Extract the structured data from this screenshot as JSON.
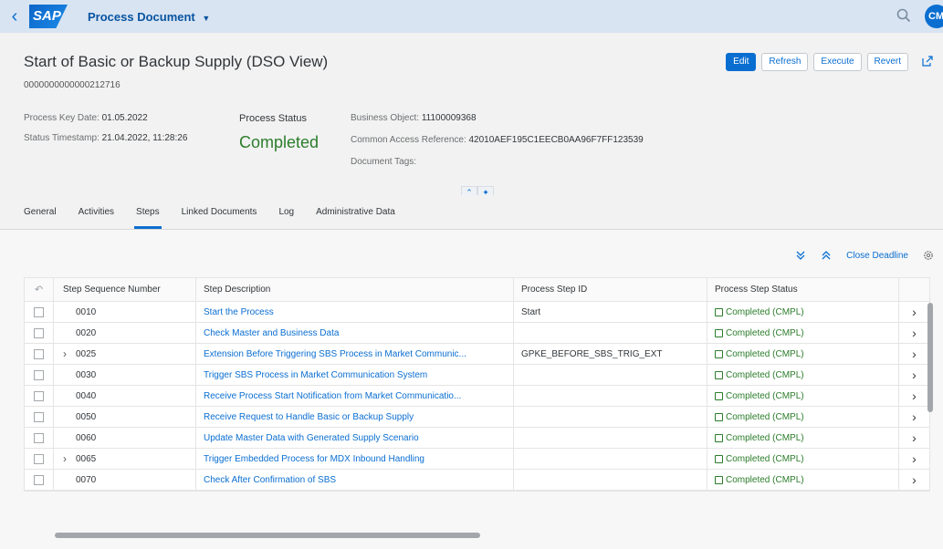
{
  "shell": {
    "logo": "SAP",
    "app_title": "Process Document",
    "avatar_initials": "CM"
  },
  "header": {
    "title": "Start of Basic or Backup Supply (DSO View)",
    "doc_number": "0000000000000212716",
    "actions": {
      "edit": "Edit",
      "refresh": "Refresh",
      "execute": "Execute",
      "revert": "Revert"
    },
    "process_key_date_label": "Process Key Date:",
    "process_key_date": "01.05.2022",
    "status_timestamp_label": "Status Timestamp:",
    "status_timestamp": "21.04.2022, 11:28:26",
    "process_status_label": "Process Status",
    "process_status": "Completed",
    "business_object_label": "Business Object:",
    "business_object": "11100009368",
    "car_label": "Common Access Reference:",
    "car_value": "42010AEF195C1EECB0AA96F7FF123539",
    "document_tags_label": "Document Tags:"
  },
  "tabs": [
    {
      "label": "General"
    },
    {
      "label": "Activities"
    },
    {
      "label": "Steps",
      "active": true
    },
    {
      "label": "Linked Documents"
    },
    {
      "label": "Log"
    },
    {
      "label": "Administrative Data"
    }
  ],
  "toolbar": {
    "close_deadline": "Close Deadline"
  },
  "table": {
    "columns": {
      "seq": "Step Sequence Number",
      "desc": "Step Description",
      "id": "Process Step ID",
      "status": "Process Step Status"
    },
    "rows": [
      {
        "seq": "0010",
        "desc": "Start the Process",
        "id": "Start",
        "status": "Completed (CMPL)",
        "expandable": false
      },
      {
        "seq": "0020",
        "desc": "Check Master and Business Data",
        "id": "",
        "status": "Completed (CMPL)",
        "expandable": false
      },
      {
        "seq": "0025",
        "desc": "Extension Before Triggering SBS Process in Market Communic...",
        "id": "GPKE_BEFORE_SBS_TRIG_EXT",
        "status": "Completed (CMPL)",
        "expandable": true
      },
      {
        "seq": "0030",
        "desc": "Trigger SBS Process in Market Communication System",
        "id": "",
        "status": "Completed (CMPL)",
        "expandable": false
      },
      {
        "seq": "0040",
        "desc": "Receive Process Start Notification from Market Communicatio...",
        "id": "",
        "status": "Completed (CMPL)",
        "expandable": false
      },
      {
        "seq": "0050",
        "desc": "Receive Request to Handle Basic or Backup Supply",
        "id": "",
        "status": "Completed (CMPL)",
        "expandable": false
      },
      {
        "seq": "0060",
        "desc": "Update Master Data with Generated Supply Scenario",
        "id": "",
        "status": "Completed (CMPL)",
        "expandable": false
      },
      {
        "seq": "0065",
        "desc": "Trigger Embedded Process for MDX Inbound Handling",
        "id": "",
        "status": "Completed (CMPL)",
        "expandable": true
      },
      {
        "seq": "0070",
        "desc": "Check After Confirmation of SBS",
        "id": "",
        "status": "Completed (CMPL)",
        "expandable": false
      }
    ]
  }
}
